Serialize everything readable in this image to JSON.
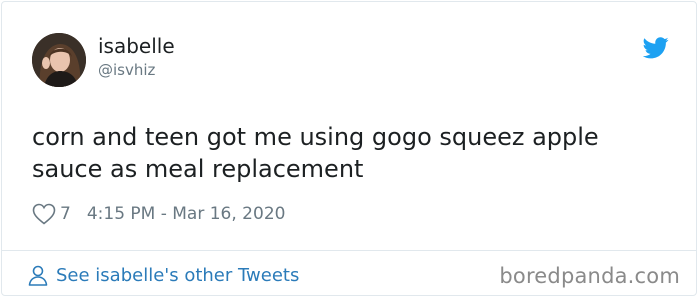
{
  "author": {
    "display_name": "isabelle",
    "handle": "@isvhiz",
    "avatar_icon": "user-avatar-photo"
  },
  "tweet": {
    "text": "corn and teen got me using gogo squeez apple sauce as meal replacement",
    "likes": "7",
    "timestamp": "4:15 PM - Mar 16, 2020"
  },
  "footer": {
    "see_more_label": "See isabelle's other Tweets"
  },
  "watermark": "boredpanda.com",
  "icons": {
    "platform": "twitter-bird-icon",
    "like": "heart-outline-icon",
    "profile": "person-outline-icon"
  },
  "colors": {
    "twitter_blue": "#1da1f2",
    "link_blue": "#2b7bb9",
    "text_primary": "#1c2022",
    "text_secondary": "#697882",
    "border": "#e1e8ed"
  }
}
